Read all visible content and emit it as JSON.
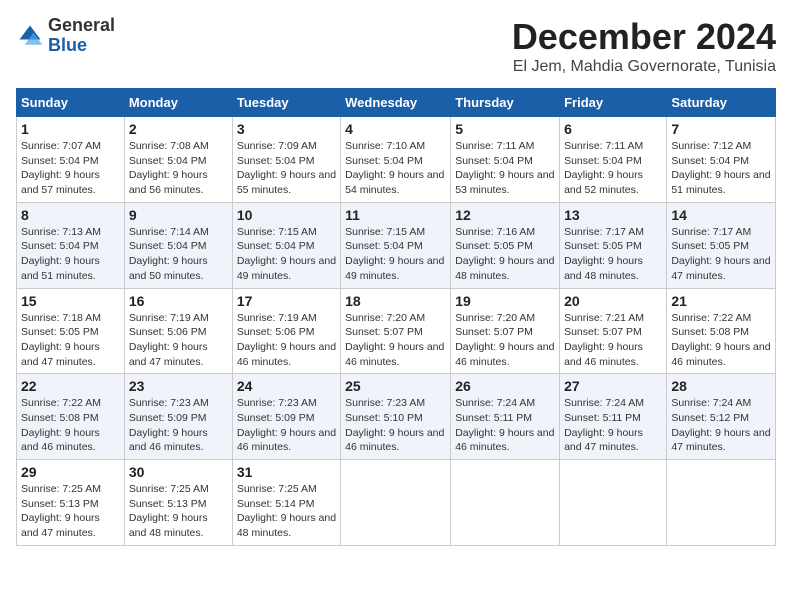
{
  "logo": {
    "general": "General",
    "blue": "Blue"
  },
  "title": "December 2024",
  "subtitle": "El Jem, Mahdia Governorate, Tunisia",
  "headers": [
    "Sunday",
    "Monday",
    "Tuesday",
    "Wednesday",
    "Thursday",
    "Friday",
    "Saturday"
  ],
  "weeks": [
    [
      {
        "day": "1",
        "sunrise": "Sunrise: 7:07 AM",
        "sunset": "Sunset: 5:04 PM",
        "daylight": "Daylight: 9 hours and 57 minutes."
      },
      {
        "day": "2",
        "sunrise": "Sunrise: 7:08 AM",
        "sunset": "Sunset: 5:04 PM",
        "daylight": "Daylight: 9 hours and 56 minutes."
      },
      {
        "day": "3",
        "sunrise": "Sunrise: 7:09 AM",
        "sunset": "Sunset: 5:04 PM",
        "daylight": "Daylight: 9 hours and 55 minutes."
      },
      {
        "day": "4",
        "sunrise": "Sunrise: 7:10 AM",
        "sunset": "Sunset: 5:04 PM",
        "daylight": "Daylight: 9 hours and 54 minutes."
      },
      {
        "day": "5",
        "sunrise": "Sunrise: 7:11 AM",
        "sunset": "Sunset: 5:04 PM",
        "daylight": "Daylight: 9 hours and 53 minutes."
      },
      {
        "day": "6",
        "sunrise": "Sunrise: 7:11 AM",
        "sunset": "Sunset: 5:04 PM",
        "daylight": "Daylight: 9 hours and 52 minutes."
      },
      {
        "day": "7",
        "sunrise": "Sunrise: 7:12 AM",
        "sunset": "Sunset: 5:04 PM",
        "daylight": "Daylight: 9 hours and 51 minutes."
      }
    ],
    [
      {
        "day": "8",
        "sunrise": "Sunrise: 7:13 AM",
        "sunset": "Sunset: 5:04 PM",
        "daylight": "Daylight: 9 hours and 51 minutes."
      },
      {
        "day": "9",
        "sunrise": "Sunrise: 7:14 AM",
        "sunset": "Sunset: 5:04 PM",
        "daylight": "Daylight: 9 hours and 50 minutes."
      },
      {
        "day": "10",
        "sunrise": "Sunrise: 7:15 AM",
        "sunset": "Sunset: 5:04 PM",
        "daylight": "Daylight: 9 hours and 49 minutes."
      },
      {
        "day": "11",
        "sunrise": "Sunrise: 7:15 AM",
        "sunset": "Sunset: 5:04 PM",
        "daylight": "Daylight: 9 hours and 49 minutes."
      },
      {
        "day": "12",
        "sunrise": "Sunrise: 7:16 AM",
        "sunset": "Sunset: 5:05 PM",
        "daylight": "Daylight: 9 hours and 48 minutes."
      },
      {
        "day": "13",
        "sunrise": "Sunrise: 7:17 AM",
        "sunset": "Sunset: 5:05 PM",
        "daylight": "Daylight: 9 hours and 48 minutes."
      },
      {
        "day": "14",
        "sunrise": "Sunrise: 7:17 AM",
        "sunset": "Sunset: 5:05 PM",
        "daylight": "Daylight: 9 hours and 47 minutes."
      }
    ],
    [
      {
        "day": "15",
        "sunrise": "Sunrise: 7:18 AM",
        "sunset": "Sunset: 5:05 PM",
        "daylight": "Daylight: 9 hours and 47 minutes."
      },
      {
        "day": "16",
        "sunrise": "Sunrise: 7:19 AM",
        "sunset": "Sunset: 5:06 PM",
        "daylight": "Daylight: 9 hours and 47 minutes."
      },
      {
        "day": "17",
        "sunrise": "Sunrise: 7:19 AM",
        "sunset": "Sunset: 5:06 PM",
        "daylight": "Daylight: 9 hours and 46 minutes."
      },
      {
        "day": "18",
        "sunrise": "Sunrise: 7:20 AM",
        "sunset": "Sunset: 5:07 PM",
        "daylight": "Daylight: 9 hours and 46 minutes."
      },
      {
        "day": "19",
        "sunrise": "Sunrise: 7:20 AM",
        "sunset": "Sunset: 5:07 PM",
        "daylight": "Daylight: 9 hours and 46 minutes."
      },
      {
        "day": "20",
        "sunrise": "Sunrise: 7:21 AM",
        "sunset": "Sunset: 5:07 PM",
        "daylight": "Daylight: 9 hours and 46 minutes."
      },
      {
        "day": "21",
        "sunrise": "Sunrise: 7:22 AM",
        "sunset": "Sunset: 5:08 PM",
        "daylight": "Daylight: 9 hours and 46 minutes."
      }
    ],
    [
      {
        "day": "22",
        "sunrise": "Sunrise: 7:22 AM",
        "sunset": "Sunset: 5:08 PM",
        "daylight": "Daylight: 9 hours and 46 minutes."
      },
      {
        "day": "23",
        "sunrise": "Sunrise: 7:23 AM",
        "sunset": "Sunset: 5:09 PM",
        "daylight": "Daylight: 9 hours and 46 minutes."
      },
      {
        "day": "24",
        "sunrise": "Sunrise: 7:23 AM",
        "sunset": "Sunset: 5:09 PM",
        "daylight": "Daylight: 9 hours and 46 minutes."
      },
      {
        "day": "25",
        "sunrise": "Sunrise: 7:23 AM",
        "sunset": "Sunset: 5:10 PM",
        "daylight": "Daylight: 9 hours and 46 minutes."
      },
      {
        "day": "26",
        "sunrise": "Sunrise: 7:24 AM",
        "sunset": "Sunset: 5:11 PM",
        "daylight": "Daylight: 9 hours and 46 minutes."
      },
      {
        "day": "27",
        "sunrise": "Sunrise: 7:24 AM",
        "sunset": "Sunset: 5:11 PM",
        "daylight": "Daylight: 9 hours and 47 minutes."
      },
      {
        "day": "28",
        "sunrise": "Sunrise: 7:24 AM",
        "sunset": "Sunset: 5:12 PM",
        "daylight": "Daylight: 9 hours and 47 minutes."
      }
    ],
    [
      {
        "day": "29",
        "sunrise": "Sunrise: 7:25 AM",
        "sunset": "Sunset: 5:13 PM",
        "daylight": "Daylight: 9 hours and 47 minutes."
      },
      {
        "day": "30",
        "sunrise": "Sunrise: 7:25 AM",
        "sunset": "Sunset: 5:13 PM",
        "daylight": "Daylight: 9 hours and 48 minutes."
      },
      {
        "day": "31",
        "sunrise": "Sunrise: 7:25 AM",
        "sunset": "Sunset: 5:14 PM",
        "daylight": "Daylight: 9 hours and 48 minutes."
      },
      null,
      null,
      null,
      null
    ]
  ]
}
